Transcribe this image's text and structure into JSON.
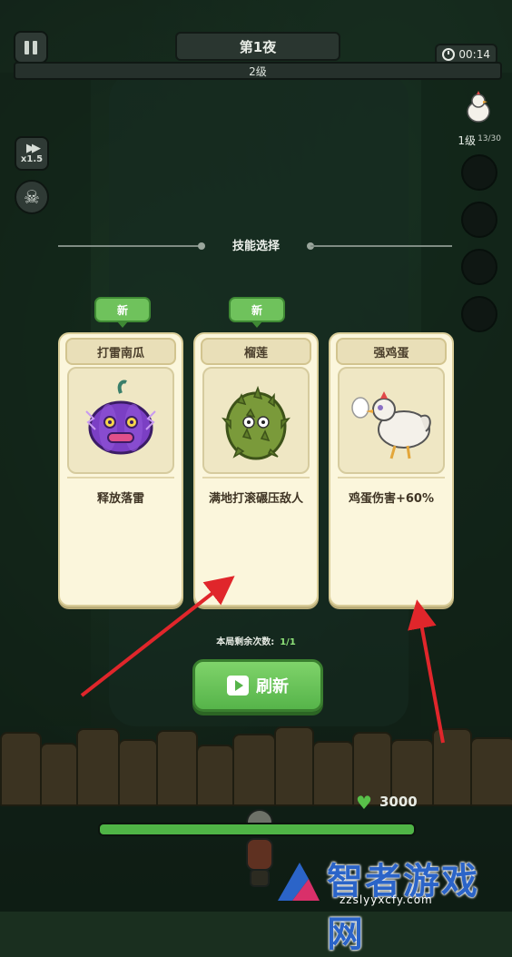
{
  "hud": {
    "night_title": "第1夜",
    "timer": "00:14",
    "level": "2级",
    "speed": "x1.5",
    "hero_level": "1级",
    "hero_xp": "13/30"
  },
  "skill_select": {
    "title": "技能选择",
    "cards": [
      {
        "name": "打雷南瓜",
        "description": "释放落雷",
        "is_new": true,
        "new_label": "新",
        "icon": "thunder-pumpkin-icon"
      },
      {
        "name": "榴莲",
        "description": "满地打滚碾压敌人",
        "is_new": true,
        "new_label": "新",
        "icon": "durian-icon"
      },
      {
        "name": "强鸡蛋",
        "description": "鸡蛋伤害+60%",
        "is_new": false,
        "icon": "chicken-egg-icon"
      }
    ],
    "remaining_label": "本局剩余次数:",
    "remaining_count": "1/1",
    "refresh_label": "刷新"
  },
  "base": {
    "hp": "3000",
    "hp_fraction": 1.0
  },
  "watermark": {
    "title": "智者游戏网",
    "url": "zzslyyxcfy.com"
  },
  "colors": {
    "accent_green": "#6fc25c",
    "card_bg": "#fbf6dc",
    "arrow_red": "#e0262b",
    "watermark_blue": "#2b64c8"
  }
}
